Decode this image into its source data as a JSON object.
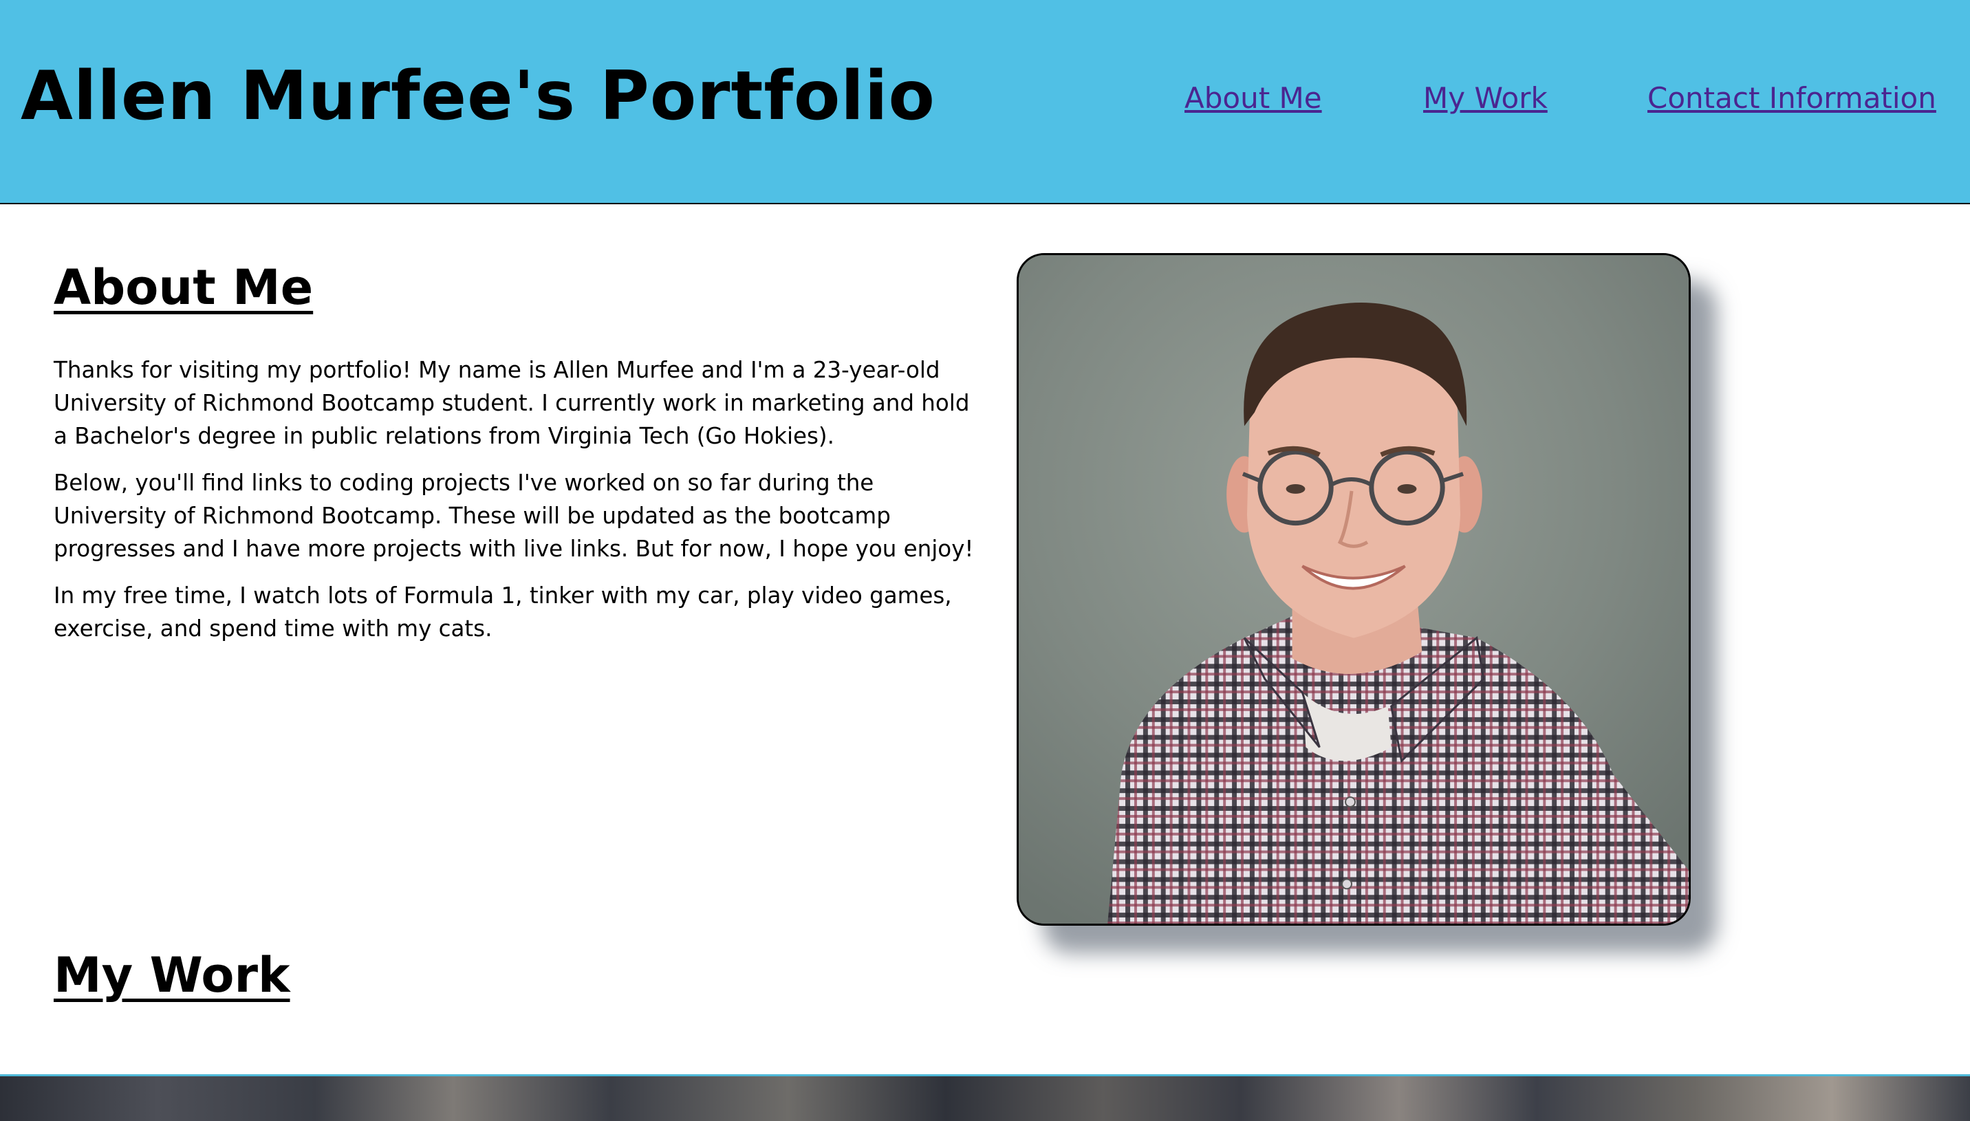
{
  "header": {
    "title": "Allen Murfee's Portfolio",
    "nav": [
      {
        "label": "About Me"
      },
      {
        "label": "My Work"
      },
      {
        "label": "Contact Information"
      }
    ]
  },
  "about": {
    "heading": "About Me",
    "paragraphs": [
      "Thanks for visiting my portfolio! My name is Allen Murfee and I'm a 23-year-old University of Richmond Bootcamp student. I currently work in marketing and hold a Bachelor's degree in public relations from Virginia Tech (Go Hokies).",
      "Below, you'll find links to coding projects I've worked on so far during the University of Richmond Bootcamp. These will be updated as the bootcamp progresses and I have more projects with live links. But for now, I hope you enjoy!",
      "In my free time, I watch lots of Formula 1, tinker with my car, play video games, exercise, and spend time with my cats."
    ]
  },
  "work": {
    "heading": "My Work"
  },
  "colors": {
    "header_bg": "#50c0e5",
    "nav_link": "#4b2590"
  }
}
